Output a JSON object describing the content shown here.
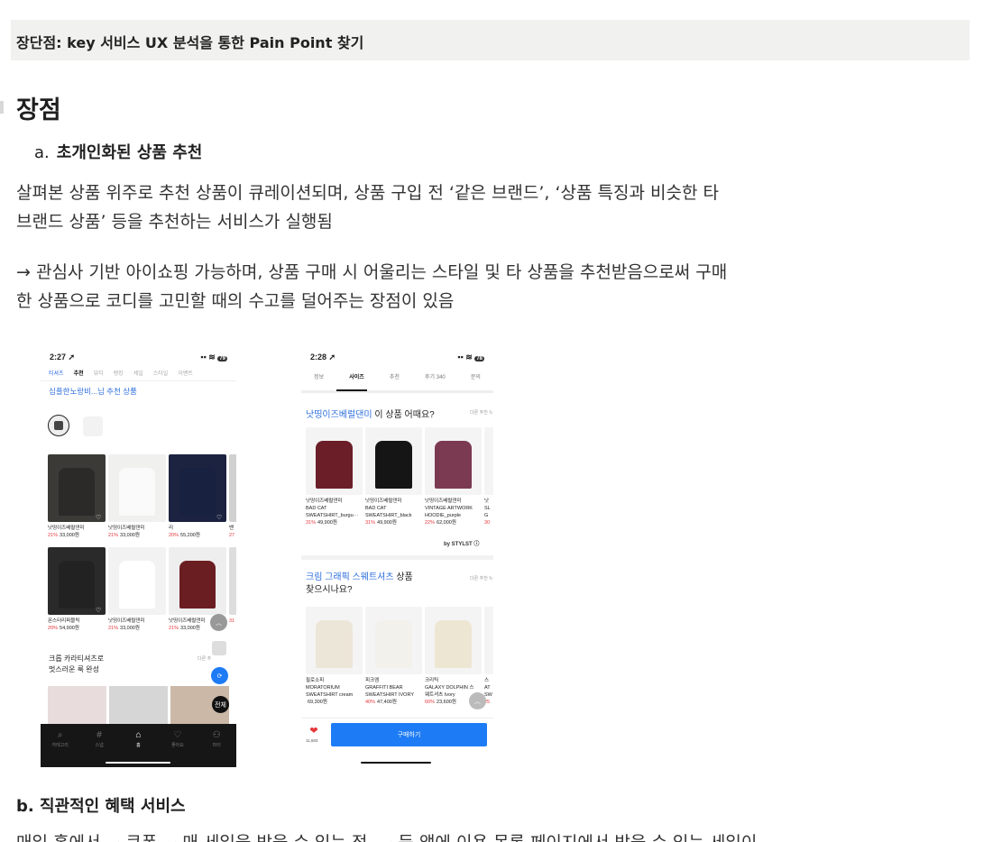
{
  "header": {
    "title": "장단점: key 서비스 UX 분석을 통한 Pain Point 찾기"
  },
  "section": {
    "title": "장점"
  },
  "item_a": {
    "num": "a.",
    "title": "초개인화된 상품 추천"
  },
  "p1": {
    "line1": "살펴본 상품 위주로 추천 상품이 큐레이션되며, 상품 구입 전 ‘같은 브랜드’, ‘상품 특징과 비슷한 타",
    "line2": "브랜드 상품’ 등을 추천하는 서비스가 실행됨"
  },
  "p2": {
    "line1": "→ 관심사 기반 아이쇼핑 가능하며, 상품 구매 시 어울리는 스타일 및 타 상품을 추천받음으로써 구매",
    "line2": "한 상품으로 코디를 고민할 때의 수고를 덜어주는 장점이 있음"
  },
  "item_b": {
    "title": "b. 직관적인 혜택 서비스"
  },
  "cut_line": "매일 홈에서 ~ 쿠폰 ~ 매 세일을 받을 수 있는 점, ~ 등 앱에 이용 목록 페이지에서 받을 수 있는 세일이",
  "phone1": {
    "time": "2:27 ➚",
    "battery": "79",
    "tabs": [
      "티셔츠",
      "추천",
      "뷰티",
      "랭킹",
      "세일",
      "스타일",
      "이벤트"
    ],
    "rec_title": "심플한노랑비...님 추천 상품",
    "row1": [
      {
        "brand": "낫띵이즈베럴댄미",
        "pct": "21%",
        "price": "33,000원",
        "bg": "#3b3a37",
        "shirt": "#2b2a28"
      },
      {
        "brand": "낫띵이즈베럴댄미",
        "pct": "21%",
        "price": "33,000원",
        "bg": "#f0f0ee",
        "shirt": "#fafafa"
      },
      {
        "brand": "리",
        "pct": "20%",
        "price": "55,200원",
        "bg": "#1c2340",
        "shirt": "#18213f"
      },
      {
        "brand": "밴",
        "pct": "27",
        "price": "",
        "bg": "#d0d0d0",
        "shirt": "#bbb"
      }
    ],
    "row2": [
      {
        "brand": "몬스터리퍼블릭",
        "pct": "20%",
        "price": "54,900원",
        "bg": "#2a2a2a",
        "shirt": "#222"
      },
      {
        "brand": "낫띵이즈베럴댄미",
        "pct": "21%",
        "price": "33,000원",
        "bg": "#f2f2f2",
        "shirt": "#fff"
      },
      {
        "brand": "낫띵이즈베럴댄미",
        "pct": "21%",
        "price": "33,000원",
        "bg": "#eee",
        "shirt": "#6b1e22"
      },
      {
        "brand": "",
        "pct": "31",
        "price": "",
        "bg": "#ddd",
        "shirt": "#e6e6e6"
      }
    ],
    "cropped_line1": "크롭 카라티셔츠로",
    "cropped_line2": "멋스러운 룩 완성",
    "cropped_more": "다른 추",
    "all_btn": "전체",
    "nav": [
      "카테고리",
      "스냅",
      "홈",
      "좋아요",
      "마이"
    ]
  },
  "phone2": {
    "time": "2:28 ➚",
    "battery": "78",
    "tabs": [
      "정보",
      "사이즈",
      "추천",
      "후기 340",
      "문의"
    ],
    "sec1_brand": "낫띵이즈베럴댄미",
    "sec1_rest": " 이 상품 어때요?",
    "more": "다른 추천",
    "items1": [
      {
        "brand": "낫띵이즈베럴댄미",
        "name1": "BAD CAT",
        "name2": "SWEATSHIRT_burgu···",
        "pct": "31%",
        "price": "49,900원",
        "color": "#6b1e28"
      },
      {
        "brand": "낫띵이즈베럴댄미",
        "name1": "BAD CAT",
        "name2": "SWEATSHIRT_black",
        "pct": "31%",
        "price": "49,900원",
        "color": "#151515"
      },
      {
        "brand": "낫띵이즈베럴댄미",
        "name1": "VINTAGE ARTWORK",
        "name2": "HOODIE_purple",
        "pct": "22%",
        "price": "62,000원",
        "color": "#7c3a52"
      },
      {
        "brand": "낫",
        "name1": "SL",
        "name2": "G",
        "pct": "30",
        "price": "",
        "color": "#555"
      }
    ],
    "byline": "by STYLST",
    "sec2_brand": "크림 그래픽 스웨트셔츠",
    "sec2_rest": " 상품",
    "sec2_line2": "찾으시나요?",
    "items2": [
      {
        "brand": "필로소피",
        "name1": "MORATORIUM",
        "name2": "SWEATSHIRT cream",
        "pct": "",
        "price": "69,300원",
        "color": "#ece6d8"
      },
      {
        "brand": "피크엠",
        "name1": "GRAFFITI BEAR",
        "name2": "SWEATSHIRT IVORY",
        "pct": "40%",
        "price": "47,400원",
        "color": "#f3f1ec"
      },
      {
        "brand": "크리틱",
        "name1": "GALAXY DOLPHIN 스",
        "name2": "웨트셔츠 Ivory",
        "pct": "60%",
        "price": "23,600원",
        "color": "#ede6d3"
      },
      {
        "brand": "스",
        "name1": "AT",
        "name2": "SW",
        "pct": "25",
        "price": "",
        "color": "#ddd"
      }
    ],
    "likes": "11,583",
    "buy_btn": "구매하기"
  },
  "colors": {
    "accent": "#2e6fdc",
    "sale": "#e8353a",
    "buy": "#1d7bf5"
  }
}
